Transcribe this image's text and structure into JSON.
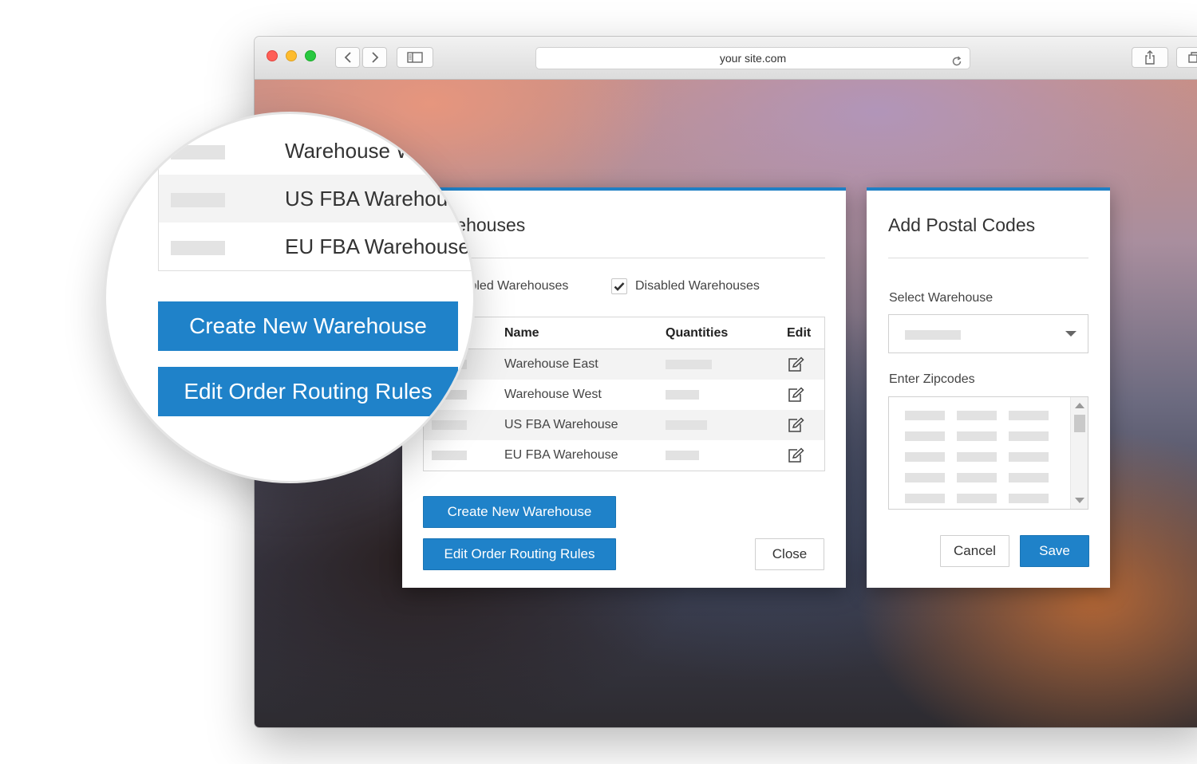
{
  "browser": {
    "url": "your site.com"
  },
  "warehouses_modal": {
    "title": "Warehouses",
    "enabled_filter_label": "Enabled Warehouses",
    "disabled_filter_label": "Disabled Warehouses",
    "disabled_checked": true,
    "columns": [
      "Name",
      "Quantities",
      "Edit"
    ],
    "rows": [
      {
        "name": "Warehouse East"
      },
      {
        "name": "Warehouse West"
      },
      {
        "name": "US FBA Warehouse"
      },
      {
        "name": "EU FBA Warehouse"
      }
    ],
    "create_button": "Create New Warehouse",
    "routing_button": "Edit Order Routing Rules",
    "close_button": "Close"
  },
  "postal_modal": {
    "title": "Add Postal Codes",
    "select_label": "Select Warehouse",
    "zip_label": "Enter Zipcodes",
    "cancel_button": "Cancel",
    "save_button": "Save"
  },
  "magnifier": {
    "rows": [
      "Warehouse West",
      "US FBA Warehouse",
      "EU FBA Warehouse"
    ],
    "create_button": "Create New Warehouse",
    "routing_button": "Edit Order Routing Rules"
  },
  "colors": {
    "accent": "#1f82c9",
    "modal_top_border": "#1f7fc5"
  },
  "icons": {
    "back": "chevron-left-icon",
    "forward": "chevron-right-icon",
    "sidebar": "sidebar-icon",
    "reload": "reload-icon",
    "share": "share-icon",
    "tabs": "tabs-icon",
    "edit": "edit-icon",
    "check": "checkmark-icon",
    "dropdown": "caret-down-icon"
  }
}
